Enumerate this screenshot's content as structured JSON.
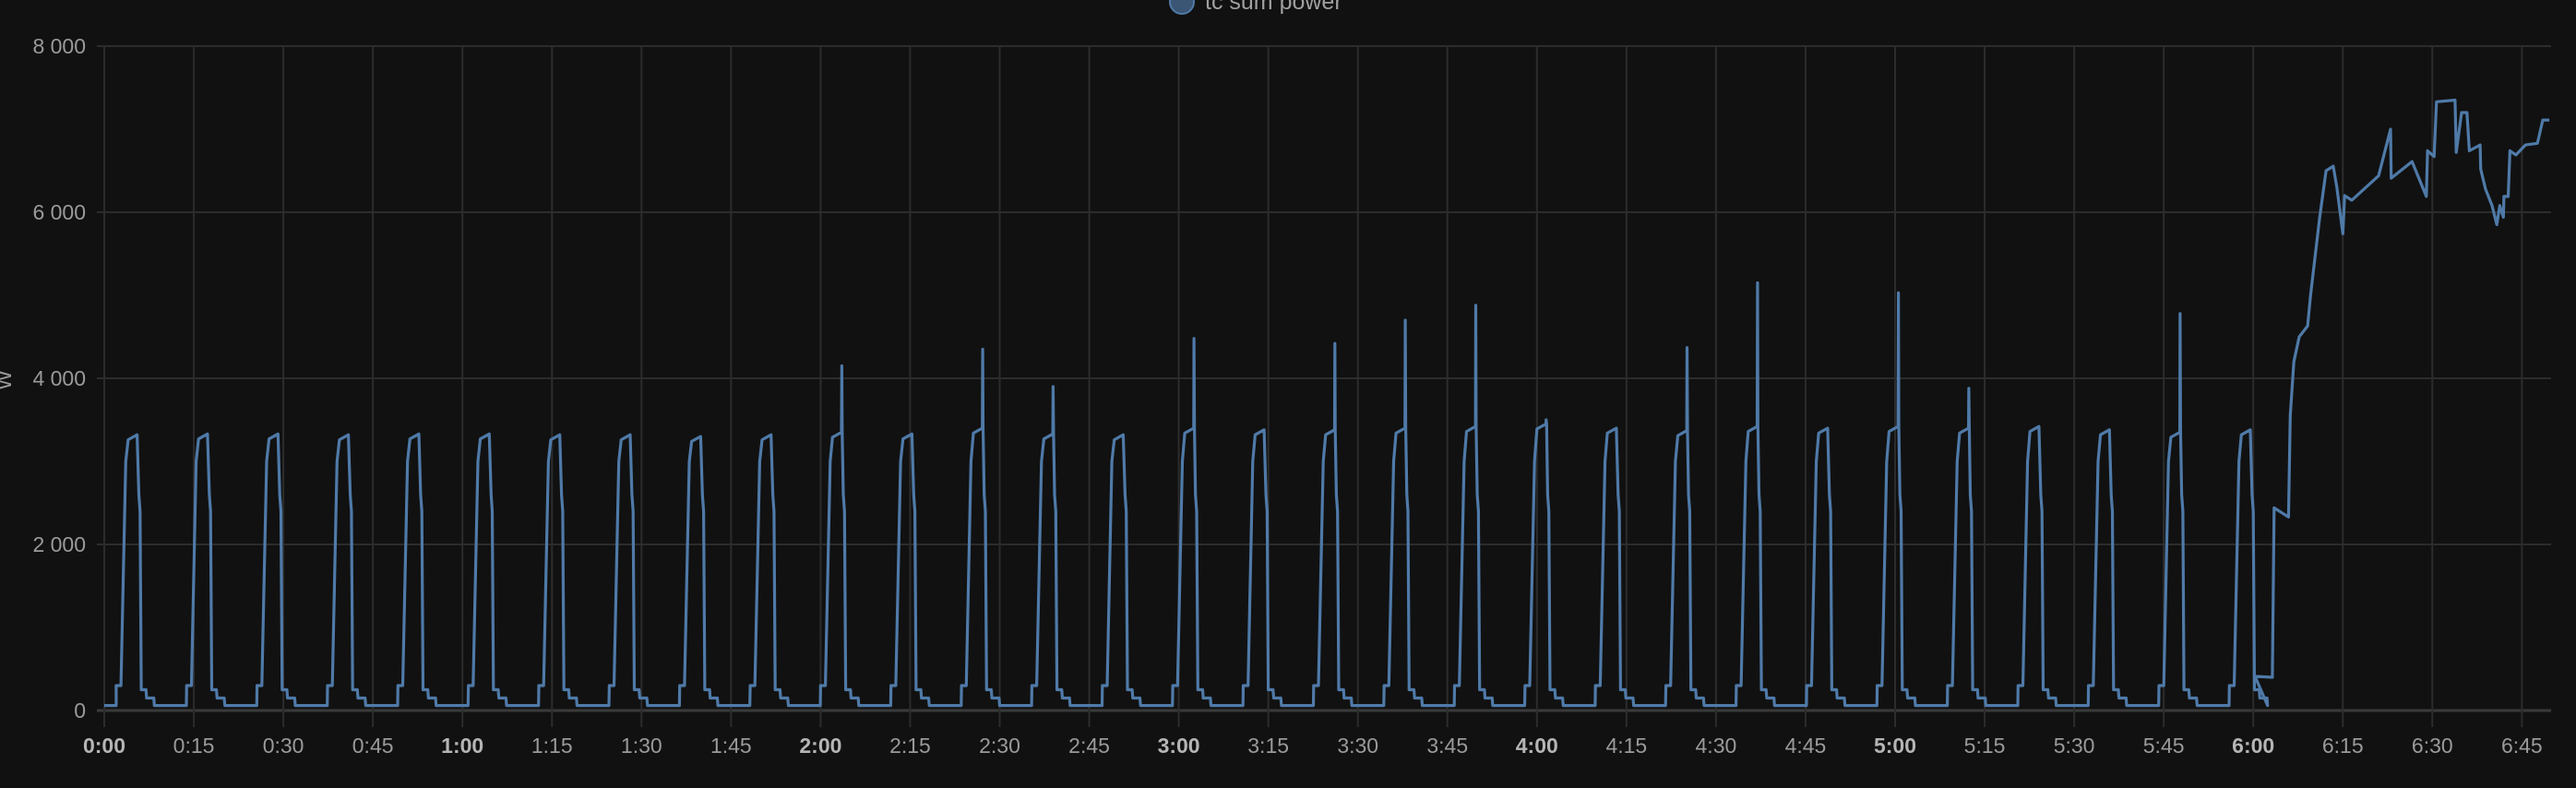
{
  "chart_data": {
    "type": "line",
    "title": "",
    "xlabel": "",
    "ylabel": "W",
    "xlim_minutes": [
      0,
      410
    ],
    "ylim": [
      0,
      8000
    ],
    "grid": true,
    "legend_placement": "top-center",
    "legend": [
      {
        "label": "tc sum power",
        "color": "#4f7aa8"
      }
    ],
    "y_ticks": [
      {
        "value": 0,
        "label": "0"
      },
      {
        "value": 2000,
        "label": "2 000"
      },
      {
        "value": 4000,
        "label": "4 000"
      },
      {
        "value": 6000,
        "label": "6 000"
      },
      {
        "value": 8000,
        "label": "8 000"
      }
    ],
    "x_ticks": [
      {
        "minute": 0,
        "label": "0:00",
        "bold": true
      },
      {
        "minute": 15,
        "label": "0:15"
      },
      {
        "minute": 30,
        "label": "0:30"
      },
      {
        "minute": 45,
        "label": "0:45"
      },
      {
        "minute": 60,
        "label": "1:00",
        "bold": true
      },
      {
        "minute": 75,
        "label": "1:15"
      },
      {
        "minute": 90,
        "label": "1:30"
      },
      {
        "minute": 105,
        "label": "1:45"
      },
      {
        "minute": 120,
        "label": "2:00",
        "bold": true
      },
      {
        "minute": 135,
        "label": "2:15"
      },
      {
        "minute": 150,
        "label": "2:30"
      },
      {
        "minute": 165,
        "label": "2:45"
      },
      {
        "minute": 180,
        "label": "3:00",
        "bold": true
      },
      {
        "minute": 195,
        "label": "3:15"
      },
      {
        "minute": 210,
        "label": "3:30"
      },
      {
        "minute": 225,
        "label": "3:45"
      },
      {
        "minute": 240,
        "label": "4:00",
        "bold": true
      },
      {
        "minute": 255,
        "label": "4:15"
      },
      {
        "minute": 270,
        "label": "4:30"
      },
      {
        "minute": 285,
        "label": "4:45"
      },
      {
        "minute": 300,
        "label": "5:00",
        "bold": true
      },
      {
        "minute": 315,
        "label": "5:15"
      },
      {
        "minute": 330,
        "label": "5:30"
      },
      {
        "minute": 345,
        "label": "5:45"
      },
      {
        "minute": 360,
        "label": "6:00",
        "bold": true
      },
      {
        "minute": 375,
        "label": "6:15"
      },
      {
        "minute": 390,
        "label": "6:30"
      },
      {
        "minute": 405,
        "label": "6:45"
      }
    ],
    "series": [
      {
        "name": "tc sum power",
        "color": "#4f7aa8",
        "cycle_first_start_min": 2,
        "cycle_period_min": 11.8,
        "cycle_count": 31,
        "cycle_profile": [
          [
            0,
            300
          ],
          [
            0.8,
            300
          ],
          [
            1.6,
            3000
          ],
          [
            2.0,
            3250
          ],
          [
            3.5,
            3300
          ],
          [
            3.8,
            2600
          ],
          [
            4.0,
            2400
          ],
          [
            4.2,
            250
          ],
          [
            5.0,
            250
          ],
          [
            5.1,
            150
          ],
          [
            6.3,
            150
          ],
          [
            6.4,
            60
          ]
        ],
        "cycle_plateaus": [
          3320,
          3330,
          3330,
          3320,
          3330,
          3330,
          3320,
          3320,
          3300,
          3320,
          3350,
          3330,
          3400,
          3330,
          3320,
          3400,
          3380,
          3380,
          3400,
          3420,
          3450,
          3400,
          3370,
          3420,
          3400,
          3420,
          3400,
          3420,
          3380,
          3350,
          3380
        ],
        "cycle_spikes": {
          "10": 4150,
          "12": 4350,
          "13": 3900,
          "15": 4480,
          "17": 4420,
          "18": 4700,
          "19": 4880,
          "20": 3500,
          "22": 4370,
          "23": 5150,
          "25": 5030,
          "26": 3880,
          "29": 4780
        },
        "tail_points": [
          [
            360.3,
            411
          ],
          [
            363.2,
            400
          ],
          [
            363.5,
            2440
          ],
          [
            365.9,
            2330
          ],
          [
            366.2,
            3550
          ],
          [
            366.8,
            4200
          ],
          [
            367.7,
            4500
          ],
          [
            369.1,
            4630
          ],
          [
            369.6,
            5000
          ],
          [
            371.1,
            5920
          ],
          [
            372.2,
            6500
          ],
          [
            373.4,
            6555
          ],
          [
            374.0,
            6300
          ],
          [
            375.0,
            5740
          ],
          [
            375.3,
            6200
          ],
          [
            376.5,
            6145
          ],
          [
            381.0,
            6440
          ],
          [
            383.0,
            7000
          ],
          [
            383.1,
            6410
          ],
          [
            386.6,
            6610
          ],
          [
            389.0,
            6190
          ],
          [
            389.2,
            6740
          ],
          [
            390.3,
            6670
          ],
          [
            390.7,
            7330
          ],
          [
            393.8,
            7350
          ],
          [
            394.0,
            6720
          ],
          [
            394.9,
            7200
          ],
          [
            395.8,
            7200
          ],
          [
            396.2,
            6740
          ],
          [
            398.0,
            6810
          ],
          [
            398.1,
            6520
          ],
          [
            398.9,
            6280
          ],
          [
            400.0,
            6080
          ],
          [
            400.8,
            5850
          ],
          [
            401.3,
            6080
          ],
          [
            401.9,
            5940
          ],
          [
            402.0,
            6190
          ],
          [
            402.7,
            6190
          ],
          [
            403.0,
            6740
          ],
          [
            404.0,
            6690
          ],
          [
            405.6,
            6810
          ],
          [
            407.6,
            6830
          ],
          [
            408.5,
            7110
          ],
          [
            409.6,
            7110
          ]
        ]
      }
    ]
  }
}
